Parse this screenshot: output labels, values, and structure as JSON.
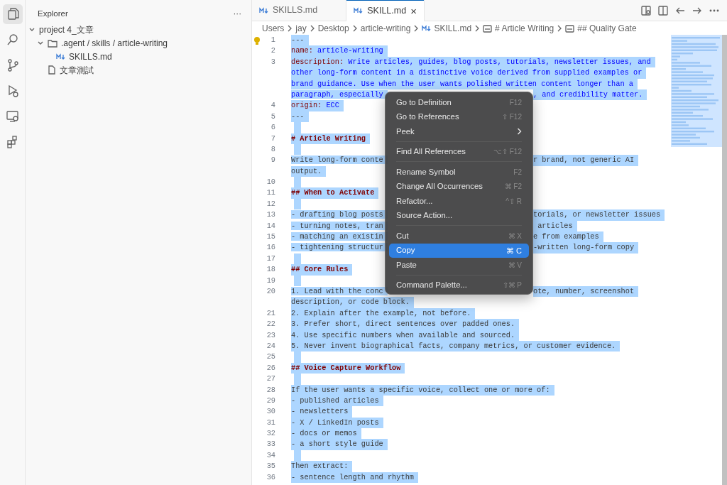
{
  "activity_bar": [
    {
      "kind": "files",
      "selected": true
    },
    {
      "kind": "search",
      "selected": false
    },
    {
      "kind": "source-control",
      "selected": false
    },
    {
      "kind": "run",
      "selected": false
    },
    {
      "kind": "remote",
      "selected": false
    },
    {
      "kind": "extensions",
      "selected": false
    }
  ],
  "sidebar": {
    "title": "Explorer",
    "more": "···",
    "tree": [
      {
        "label": "project 4_文章",
        "expanded": true,
        "children": [
          {
            "label": ".agent / skills / article-writing",
            "kind": "folder",
            "expanded": true,
            "children": [
              {
                "label": "SKILLS.md",
                "kind": "markdown"
              }
            ]
          },
          {
            "label": "文章測試",
            "kind": "file"
          }
        ]
      }
    ]
  },
  "tabs": [
    {
      "label": "SKILLS.md",
      "selected": false
    },
    {
      "label": "SKILL.md",
      "selected": true,
      "close": "×"
    }
  ],
  "breadcrumb": [
    {
      "label": "Users",
      "kind": "plain"
    },
    {
      "label": "jay",
      "kind": "plain"
    },
    {
      "label": "Desktop",
      "kind": "plain"
    },
    {
      "label": "article-writing",
      "kind": "plain"
    },
    {
      "label": "SKILL.md",
      "kind": "markdown"
    },
    {
      "label": "# Article Writing",
      "kind": "symbol"
    },
    {
      "label": "## Quality Gate",
      "kind": "symbol"
    }
  ],
  "lines": [
    {
      "number": "1",
      "rows": [
        {
          "segments": [
            {
              "text": "---",
              "kind": "plain"
            }
          ]
        }
      ]
    },
    {
      "number": "2",
      "rows": [
        {
          "segments": [
            {
              "text": "name:",
              "kind": "key"
            },
            {
              "text": " article-writing",
              "kind": "value"
            }
          ]
        }
      ]
    },
    {
      "number": "3",
      "rows": [
        {
          "segments": [
            {
              "text": "description:",
              "kind": "key"
            },
            {
              "text": " Write articles, guides, blog posts, tutorials, newsletter issues, and",
              "kind": "value"
            }
          ]
        },
        {
          "segments": [
            {
              "text": "other long-form content in a distinctive voice derived from supplied examples or",
              "kind": "value"
            }
          ]
        },
        {
          "segments": [
            {
              "text": "brand guidance. Use when the user wants polished written content longer than a",
              "kind": "value"
            }
          ]
        },
        {
          "segments": [
            {
              "text": "paragraph, especially",
              "kind": "value"
            }
          ],
          "after_menu": [
            {
              "text": ", and credibility matter.",
              "kind": "value"
            }
          ]
        }
      ]
    },
    {
      "number": "4",
      "rows": [
        {
          "segments": [
            {
              "text": "origin:",
              "kind": "key"
            },
            {
              "text": " ECC",
              "kind": "value"
            }
          ]
        }
      ]
    },
    {
      "number": "5",
      "rows": [
        {
          "segments": [
            {
              "text": "---",
              "kind": "plain"
            }
          ]
        }
      ]
    },
    {
      "number": "6",
      "rows": [
        {
          "segments": []
        }
      ]
    },
    {
      "number": "7",
      "rows": [
        {
          "segments": [
            {
              "text": "# Article Writing",
              "kind": "heading"
            }
          ]
        }
      ]
    },
    {
      "number": "8",
      "rows": [
        {
          "segments": []
        }
      ]
    },
    {
      "number": "9",
      "rows": [
        {
          "segments": [
            {
              "text": "Write long-form conte",
              "kind": "plain"
            }
          ],
          "after_menu": [
            {
              "text": "r brand, not generic AI",
              "kind": "plain"
            }
          ]
        },
        {
          "segments": [
            {
              "text": "output.",
              "kind": "plain"
            }
          ]
        }
      ]
    },
    {
      "number": "10",
      "rows": [
        {
          "segments": []
        }
      ]
    },
    {
      "number": "11",
      "rows": [
        {
          "segments": [
            {
              "text": "## When to Activate",
              "kind": "heading"
            }
          ]
        }
      ]
    },
    {
      "number": "12",
      "rows": [
        {
          "segments": []
        }
      ]
    },
    {
      "number": "13",
      "rows": [
        {
          "segments": [
            {
              "text": "- drafting blog posts",
              "kind": "plain"
            }
          ],
          "after_menu": [
            {
              "text": "torials, or newsletter issues",
              "kind": "plain"
            }
          ]
        }
      ]
    },
    {
      "number": "14",
      "rows": [
        {
          "segments": [
            {
              "text": "- turning notes, tran",
              "kind": "plain"
            }
          ],
          "after_menu": [
            {
              "text": " articles",
              "kind": "plain"
            }
          ]
        }
      ]
    },
    {
      "number": "15",
      "rows": [
        {
          "segments": [
            {
              "text": "- matching an existin",
              "kind": "plain"
            }
          ],
          "after_menu": [
            {
              "text": "e from examples",
              "kind": "plain"
            }
          ]
        }
      ]
    },
    {
      "number": "16",
      "rows": [
        {
          "segments": [
            {
              "text": "- tightening structur",
              "kind": "plain"
            }
          ],
          "after_menu": [
            {
              "text": "-written long-form copy",
              "kind": "plain"
            }
          ]
        }
      ]
    },
    {
      "number": "17",
      "rows": [
        {
          "segments": []
        }
      ]
    },
    {
      "number": "18",
      "rows": [
        {
          "segments": [
            {
              "text": "## Core Rules",
              "kind": "heading"
            }
          ]
        }
      ]
    },
    {
      "number": "19",
      "rows": [
        {
          "segments": []
        }
      ]
    },
    {
      "number": "20",
      "rows": [
        {
          "segments": [
            {
              "text": "1. Lead with the conc",
              "kind": "plain"
            }
          ],
          "after_menu": [
            {
              "text": "ote, number, screenshot",
              "kind": "plain"
            }
          ]
        },
        {
          "segments": [
            {
              "text": "description, or code block.",
              "kind": "plain"
            }
          ]
        }
      ]
    },
    {
      "number": "21",
      "rows": [
        {
          "segments": [
            {
              "text": "2. Explain after the example, not before.",
              "kind": "plain"
            }
          ]
        }
      ]
    },
    {
      "number": "22",
      "rows": [
        {
          "segments": [
            {
              "text": "3. Prefer short, direct sentences over padded ones.",
              "kind": "plain"
            }
          ]
        }
      ]
    },
    {
      "number": "23",
      "rows": [
        {
          "segments": [
            {
              "text": "4. Use specific numbers when available and sourced.",
              "kind": "plain"
            }
          ]
        }
      ]
    },
    {
      "number": "24",
      "rows": [
        {
          "segments": [
            {
              "text": "5. Never invent biographical facts, company metrics, or customer evidence.",
              "kind": "plain"
            }
          ]
        }
      ]
    },
    {
      "number": "25",
      "rows": [
        {
          "segments": []
        }
      ]
    },
    {
      "number": "26",
      "rows": [
        {
          "segments": [
            {
              "text": "## Voice Capture Workflow",
              "kind": "heading"
            }
          ]
        }
      ]
    },
    {
      "number": "27",
      "rows": [
        {
          "segments": []
        }
      ]
    },
    {
      "number": "28",
      "rows": [
        {
          "segments": [
            {
              "text": "If the user wants a specific voice, collect one or more of:",
              "kind": "plain"
            }
          ]
        }
      ]
    },
    {
      "number": "29",
      "rows": [
        {
          "segments": [
            {
              "text": "- published articles",
              "kind": "plain"
            }
          ]
        }
      ]
    },
    {
      "number": "30",
      "rows": [
        {
          "segments": [
            {
              "text": "- newsletters",
              "kind": "plain"
            }
          ]
        }
      ]
    },
    {
      "number": "31",
      "rows": [
        {
          "segments": [
            {
              "text": "- X / LinkedIn posts",
              "kind": "plain"
            }
          ]
        }
      ]
    },
    {
      "number": "32",
      "rows": [
        {
          "segments": [
            {
              "text": "- docs or memos",
              "kind": "plain"
            }
          ]
        }
      ]
    },
    {
      "number": "33",
      "rows": [
        {
          "segments": [
            {
              "text": "- a short style guide",
              "kind": "plain"
            }
          ]
        }
      ]
    },
    {
      "number": "34",
      "rows": [
        {
          "segments": []
        }
      ]
    },
    {
      "number": "35",
      "rows": [
        {
          "segments": [
            {
              "text": "Then extract:",
              "kind": "plain"
            }
          ]
        }
      ]
    },
    {
      "number": "36",
      "rows": [
        {
          "segments": [
            {
              "text": "- sentence length and rhythm",
              "kind": "plain"
            }
          ]
        }
      ]
    }
  ],
  "context_menu": [
    {
      "kind": "item",
      "label": "Go to Definition",
      "shortcut": "F12",
      "selected": false
    },
    {
      "kind": "item",
      "label": "Go to References",
      "shortcut": "⇧ F12",
      "selected": false
    },
    {
      "kind": "item",
      "label": "Peek",
      "submenu": true,
      "selected": false
    },
    {
      "kind": "separator"
    },
    {
      "kind": "item",
      "label": "Find All References",
      "shortcut": "⌥⇧ F12",
      "selected": false
    },
    {
      "kind": "separator"
    },
    {
      "kind": "item",
      "label": "Rename Symbol",
      "shortcut": "F2",
      "selected": false
    },
    {
      "kind": "item",
      "label": "Change All Occurrences",
      "shortcut": "⌘ F2",
      "selected": false
    },
    {
      "kind": "item",
      "label": "Refactor...",
      "shortcut": "^⇧ R",
      "selected": false
    },
    {
      "kind": "item",
      "label": "Source Action...",
      "selected": false
    },
    {
      "kind": "separator"
    },
    {
      "kind": "item",
      "label": "Cut",
      "shortcut": "⌘ X",
      "selected": false
    },
    {
      "kind": "item",
      "label": "Copy",
      "shortcut": "⌘ C",
      "selected": true
    },
    {
      "kind": "item",
      "label": "Paste",
      "shortcut": "⌘ V",
      "selected": false
    },
    {
      "kind": "separator"
    },
    {
      "kind": "item",
      "label": "Command Palette...",
      "shortcut": "⇧⌘ P",
      "selected": false
    }
  ]
}
